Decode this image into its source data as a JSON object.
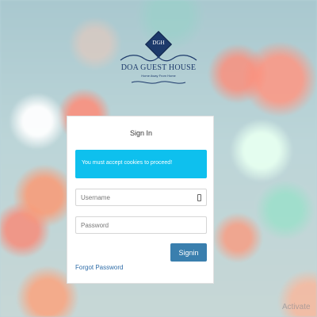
{
  "logo": {
    "monogram": "DGH",
    "name": "DOA GUEST HOUSE",
    "tagline": "Home Away From Home"
  },
  "login": {
    "title": "Sign In",
    "alert": "You must accept cookies to proceed!",
    "username_placeholder": "Username",
    "password_placeholder": "Password",
    "signin_label": "Signin",
    "forgot_label": "Forgot Password"
  },
  "watermark": "Activate",
  "colors": {
    "brand_navy": "#1d3a6b",
    "alert_bg": "#0ec0ee",
    "button_bg": "#3a7fae",
    "link": "#2f6da8"
  },
  "icons": {
    "username_field": "keyboard-icon"
  }
}
